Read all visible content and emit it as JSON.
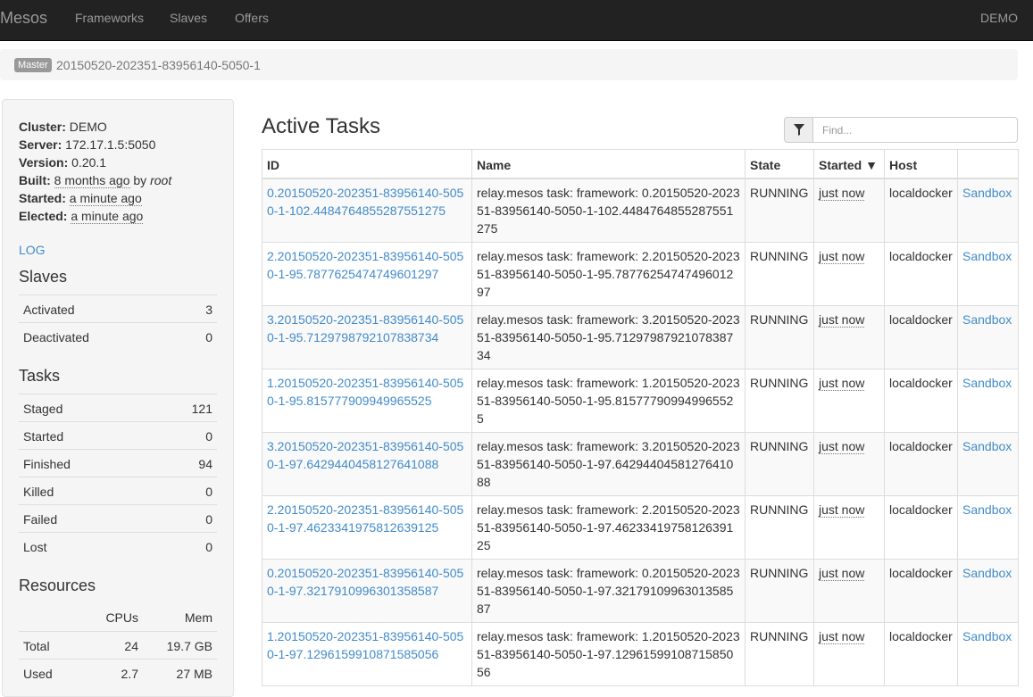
{
  "navbar": {
    "brand": "Mesos",
    "items": [
      "Frameworks",
      "Slaves",
      "Offers"
    ],
    "cluster": "DEMO"
  },
  "breadcrumb": {
    "badge": "Master",
    "id": "20150520-202351-83956140-5050-1"
  },
  "sidebar": {
    "cluster_label": "Cluster:",
    "cluster": "DEMO",
    "server_label": "Server:",
    "server": "172.17.1.5:5050",
    "version_label": "Version:",
    "version": "0.20.1",
    "built_label": "Built:",
    "built_time": "8 months ago",
    "built_by": "by",
    "built_user": "root",
    "started_label": "Started:",
    "started": "a minute ago",
    "elected_label": "Elected:",
    "elected": "a minute ago",
    "log": "LOG",
    "slaves_title": "Slaves",
    "slaves": [
      {
        "label": "Activated",
        "value": "3"
      },
      {
        "label": "Deactivated",
        "value": "0"
      }
    ],
    "tasks_title": "Tasks",
    "tasks": [
      {
        "label": "Staged",
        "value": "121"
      },
      {
        "label": "Started",
        "value": "0"
      },
      {
        "label": "Finished",
        "value": "94"
      },
      {
        "label": "Killed",
        "value": "0"
      },
      {
        "label": "Failed",
        "value": "0"
      },
      {
        "label": "Lost",
        "value": "0"
      }
    ],
    "resources_title": "Resources",
    "resources_headers": [
      "CPUs",
      "Mem"
    ],
    "resources": [
      {
        "label": "Total",
        "cpus": "24",
        "mem": "19.7 GB"
      },
      {
        "label": "Used",
        "cpus": "2.7",
        "mem": "27 MB"
      }
    ]
  },
  "main": {
    "title": "Active Tasks",
    "find_placeholder": "Find...",
    "columns": [
      "ID",
      "Name",
      "State",
      "Started ▼",
      "Host",
      ""
    ],
    "rows": [
      {
        "id": "0.20150520-202351-83956140-5050-1-102.4484764855287551275",
        "name": "relay.mesos task: framework: 0.20150520-202351-83956140-5050-1-102.4484764855287551275",
        "state": "RUNNING",
        "started": "just now",
        "host": "localdocker",
        "link": "Sandbox"
      },
      {
        "id": "2.20150520-202351-83956140-5050-1-95.7877625474749601297",
        "name": "relay.mesos task: framework: 2.20150520-202351-83956140-5050-1-95.7877625474749601297",
        "state": "RUNNING",
        "started": "just now",
        "host": "localdocker",
        "link": "Sandbox"
      },
      {
        "id": "3.20150520-202351-83956140-5050-1-95.7129798792107838734",
        "name": "relay.mesos task: framework: 3.20150520-202351-83956140-5050-1-95.7129798792107838734",
        "state": "RUNNING",
        "started": "just now",
        "host": "localdocker",
        "link": "Sandbox"
      },
      {
        "id": "1.20150520-202351-83956140-5050-1-95.815777909949965525",
        "name": "relay.mesos task: framework: 1.20150520-202351-83956140-5050-1-95.815777909949965525",
        "state": "RUNNING",
        "started": "just now",
        "host": "localdocker",
        "link": "Sandbox"
      },
      {
        "id": "3.20150520-202351-83956140-5050-1-97.6429440458127641088",
        "name": "relay.mesos task: framework: 3.20150520-202351-83956140-5050-1-97.6429440458127641088",
        "state": "RUNNING",
        "started": "just now",
        "host": "localdocker",
        "link": "Sandbox"
      },
      {
        "id": "2.20150520-202351-83956140-5050-1-97.4623341975812639125",
        "name": "relay.mesos task: framework: 2.20150520-202351-83956140-5050-1-97.4623341975812639125",
        "state": "RUNNING",
        "started": "just now",
        "host": "localdocker",
        "link": "Sandbox"
      },
      {
        "id": "0.20150520-202351-83956140-5050-1-97.3217910996301358587",
        "name": "relay.mesos task: framework: 0.20150520-202351-83956140-5050-1-97.3217910996301358587",
        "state": "RUNNING",
        "started": "just now",
        "host": "localdocker",
        "link": "Sandbox"
      },
      {
        "id": "1.20150520-202351-83956140-5050-1-97.1296159910871585056",
        "name": "relay.mesos task: framework: 1.20150520-202351-83956140-5050-1-97.1296159910871585056",
        "state": "RUNNING",
        "started": "just now",
        "host": "localdocker",
        "link": "Sandbox"
      }
    ]
  }
}
